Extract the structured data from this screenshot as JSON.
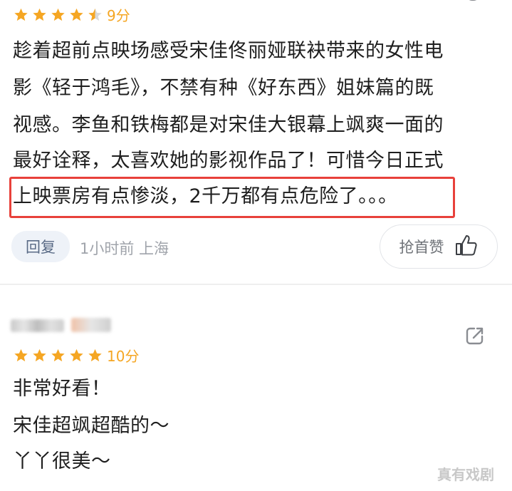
{
  "colors": {
    "star": "#f5a623",
    "highlight_border": "#e8413b",
    "reply_bg": "#eef2f8"
  },
  "comment1": {
    "rating": {
      "stars": 4.5,
      "score_text": "9分"
    },
    "lines": [
      "趁着超前点映场感受宋佳佟丽娅联袂带来的女性电",
      "影《轻于鸿毛》，不禁有种《好东西》姐妹篇的既",
      "视感。李鱼和铁梅都是对宋佳大银幕上飒爽一面的",
      "最好诠释，太喜欢她的影视作品了！可惜今日正式"
    ],
    "highlight_line": "上映票房有点惨淡，2千万都有点危险了。。。",
    "reply_label": "回复",
    "time_location": "1小时前  上海",
    "like_label": "抢首赞",
    "like_icon": "thumbs-up-icon"
  },
  "comment2": {
    "rating": {
      "stars": 5,
      "score_text": "10分"
    },
    "lines": [
      "非常好看！",
      "宋佳超飒超酷的～",
      "丫丫很美～"
    ],
    "share_icon": "share-icon"
  },
  "watermark": "真有戏剧"
}
